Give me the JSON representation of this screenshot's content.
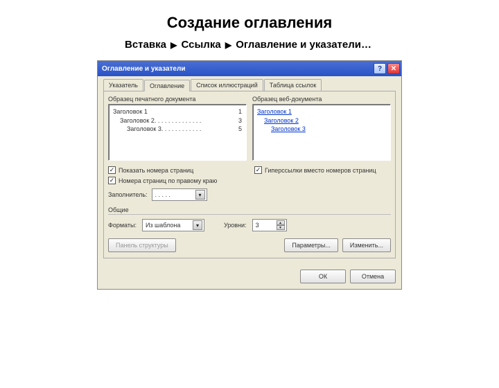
{
  "slide_title": "Создание оглавления",
  "breadcrumb": {
    "step1": "Вставка",
    "step2": "Ссылка",
    "step3": "Оглавление и указатели…"
  },
  "dialog": {
    "title": "Оглавление и указатели",
    "tabs": [
      "Указатель",
      "Оглавление",
      "Список иллюстраций",
      "Таблица ссылок"
    ],
    "active_tab": 1,
    "preview_print_label": "Образец печатного документа",
    "preview_web_label": "Образец веб-документа",
    "print_lines": [
      {
        "text": "Заголовок 1",
        "page": "1"
      },
      {
        "text": "Заголовок 2",
        "dots": ". . . . . . . . . . . . . .",
        "page": "3"
      },
      {
        "text": "Заголовок 3",
        "dots": ". . . . . . . . . . . .",
        "page": "5"
      }
    ],
    "web_lines": [
      "Заголовок 1",
      "Заголовок 2",
      "Заголовок 3"
    ],
    "check_show_page": "Показать номера страниц",
    "check_right_align": "Номера страниц по правому краю",
    "check_hyperlinks": "Гиперссылки вместо номеров страниц",
    "filler_label": "Заполнитель:",
    "filler_value": ". . . . .",
    "section_general": "Общие",
    "formats_label": "Форматы:",
    "formats_value": "Из шаблона",
    "levels_label": "Уровни:",
    "levels_value": "3",
    "btn_show_structure": "Панель структуры",
    "btn_options": "Параметры...",
    "btn_modify": "Изменить...",
    "btn_ok": "ОК",
    "btn_cancel": "Отмена"
  }
}
